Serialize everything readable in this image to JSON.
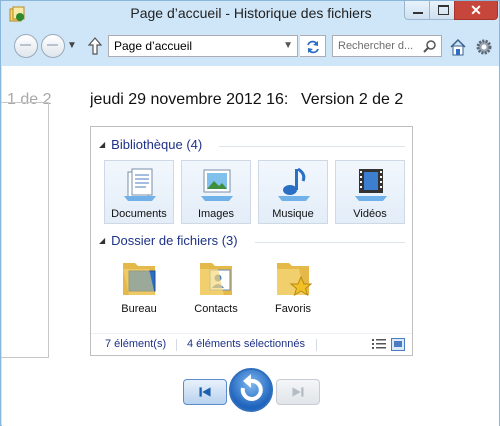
{
  "window": {
    "title": "Page d’accueil - Historique des fichiers",
    "close_glyph": "✕"
  },
  "nav": {
    "address": "Page d’accueil",
    "search_placeholder": "Rechercher d..."
  },
  "version": {
    "prev_label": "1 de 2",
    "date": "jeudi 29 novembre 2012 16:",
    "version": "Version 2 de 2"
  },
  "library": {
    "header": "Bibliothèque (4)",
    "tiles": [
      {
        "label": "Documents",
        "icon": "documents-icon"
      },
      {
        "label": "Images",
        "icon": "images-icon"
      },
      {
        "label": "Musique",
        "icon": "music-icon"
      },
      {
        "label": "Vidéos",
        "icon": "videos-icon"
      }
    ]
  },
  "folders": {
    "header": "Dossier de fichiers (3)",
    "items": [
      {
        "label": "Bureau",
        "icon": "desktop-folder-icon"
      },
      {
        "label": "Contacts",
        "icon": "contacts-folder-icon"
      },
      {
        "label": "Favoris",
        "icon": "favorites-folder-icon"
      }
    ]
  },
  "status": {
    "count": "7 élément(s)",
    "selected": "4 éléments sélectionnés"
  },
  "colors": {
    "chrome": "#cfe6f8",
    "link_blue": "#1e3287",
    "close_red": "#c7463b"
  }
}
